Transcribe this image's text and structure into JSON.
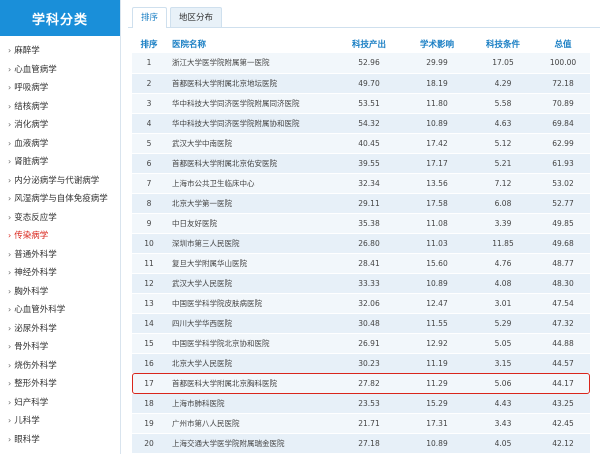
{
  "sidebar": {
    "title": "学科分类",
    "items": [
      {
        "label": "麻醉学"
      },
      {
        "label": "心血管病学"
      },
      {
        "label": "呼吸病学"
      },
      {
        "label": "结核病学"
      },
      {
        "label": "消化病学"
      },
      {
        "label": "血液病学"
      },
      {
        "label": "肾脏病学"
      },
      {
        "label": "内分泌病学与代谢病学"
      },
      {
        "label": "风湿病学与自体免疫病学"
      },
      {
        "label": "变态反应学"
      },
      {
        "label": "传染病学",
        "active": true
      },
      {
        "label": "普通外科学"
      },
      {
        "label": "神经外科学"
      },
      {
        "label": "胸外科学"
      },
      {
        "label": "心血管外科学"
      },
      {
        "label": "泌尿外科学"
      },
      {
        "label": "骨外科学"
      },
      {
        "label": "烧伤外科学"
      },
      {
        "label": "整形外科学"
      },
      {
        "label": "妇产科学"
      },
      {
        "label": "儿科学"
      },
      {
        "label": "眼科学"
      }
    ]
  },
  "tabs": [
    {
      "label": "排序",
      "active": true
    },
    {
      "label": "地区分布",
      "active": false
    }
  ],
  "table": {
    "headers": {
      "rank": "排序",
      "name": "医院名称",
      "tech_output": "科技产出",
      "academic": "学术影响",
      "conditions": "科技条件",
      "total": "总值"
    },
    "rows": [
      {
        "rank": "1",
        "name": "浙江大学医学院附属第一医院",
        "tech_output": "52.96",
        "academic": "29.99",
        "conditions": "17.05",
        "total": "100.00"
      },
      {
        "rank": "2",
        "name": "首都医科大学附属北京地坛医院",
        "tech_output": "49.70",
        "academic": "18.19",
        "conditions": "4.29",
        "total": "72.18"
      },
      {
        "rank": "3",
        "name": "华中科技大学同济医学院附属同济医院",
        "tech_output": "53.51",
        "academic": "11.80",
        "conditions": "5.58",
        "total": "70.89"
      },
      {
        "rank": "4",
        "name": "华中科技大学同济医学院附属协和医院",
        "tech_output": "54.32",
        "academic": "10.89",
        "conditions": "4.63",
        "total": "69.84"
      },
      {
        "rank": "5",
        "name": "武汉大学中南医院",
        "tech_output": "40.45",
        "academic": "17.42",
        "conditions": "5.12",
        "total": "62.99"
      },
      {
        "rank": "6",
        "name": "首都医科大学附属北京佑安医院",
        "tech_output": "39.55",
        "academic": "17.17",
        "conditions": "5.21",
        "total": "61.93"
      },
      {
        "rank": "7",
        "name": "上海市公共卫生临床中心",
        "tech_output": "32.34",
        "academic": "13.56",
        "conditions": "7.12",
        "total": "53.02"
      },
      {
        "rank": "8",
        "name": "北京大学第一医院",
        "tech_output": "29.11",
        "academic": "17.58",
        "conditions": "6.08",
        "total": "52.77"
      },
      {
        "rank": "9",
        "name": "中日友好医院",
        "tech_output": "35.38",
        "academic": "11.08",
        "conditions": "3.39",
        "total": "49.85"
      },
      {
        "rank": "10",
        "name": "深圳市第三人民医院",
        "tech_output": "26.80",
        "academic": "11.03",
        "conditions": "11.85",
        "total": "49.68"
      },
      {
        "rank": "11",
        "name": "复旦大学附属华山医院",
        "tech_output": "28.41",
        "academic": "15.60",
        "conditions": "4.76",
        "total": "48.77"
      },
      {
        "rank": "12",
        "name": "武汉大学人民医院",
        "tech_output": "33.33",
        "academic": "10.89",
        "conditions": "4.08",
        "total": "48.30"
      },
      {
        "rank": "13",
        "name": "中国医学科学院皮肤病医院",
        "tech_output": "32.06",
        "academic": "12.47",
        "conditions": "3.01",
        "total": "47.54"
      },
      {
        "rank": "14",
        "name": "四川大学华西医院",
        "tech_output": "30.48",
        "academic": "11.55",
        "conditions": "5.29",
        "total": "47.32"
      },
      {
        "rank": "15",
        "name": "中国医学科学院北京协和医院",
        "tech_output": "26.91",
        "academic": "12.92",
        "conditions": "5.05",
        "total": "44.88"
      },
      {
        "rank": "16",
        "name": "北京大学人民医院",
        "tech_output": "30.23",
        "academic": "11.19",
        "conditions": "3.15",
        "total": "44.57"
      },
      {
        "rank": "17",
        "name": "首都医科大学附属北京胸科医院",
        "tech_output": "27.82",
        "academic": "11.29",
        "conditions": "5.06",
        "total": "44.17",
        "highlighted": true
      },
      {
        "rank": "18",
        "name": "上海市肺科医院",
        "tech_output": "23.53",
        "academic": "15.29",
        "conditions": "4.43",
        "total": "43.25"
      },
      {
        "rank": "19",
        "name": "广州市第八人民医院",
        "tech_output": "21.71",
        "academic": "17.31",
        "conditions": "3.43",
        "total": "42.45"
      },
      {
        "rank": "20",
        "name": "上海交通大学医学院附属瑞金医院",
        "tech_output": "27.18",
        "academic": "10.89",
        "conditions": "4.05",
        "total": "42.12"
      }
    ]
  },
  "colors": {
    "header_blue": "#1a8fd9",
    "column_header_text": "#1a7fc4",
    "active_red": "#d9261c",
    "row_light": "#f2f7fb",
    "row_dark": "#e7f0f8"
  }
}
